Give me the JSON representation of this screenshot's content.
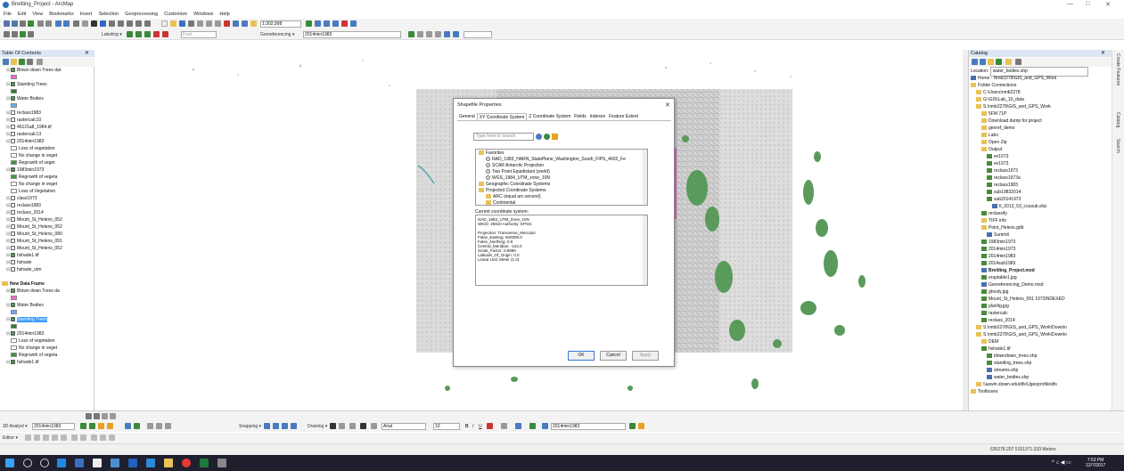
{
  "window": {
    "title": "Breitling_Project - ArcMap",
    "controls": [
      "—",
      "□",
      "✕"
    ]
  },
  "menu": [
    "File",
    "Edit",
    "View",
    "Bookmarks",
    "Insert",
    "Selection",
    "Geoprocessing",
    "Customize",
    "Windows",
    "Help"
  ],
  "toolbar": {
    "scale_value": "1:302,998",
    "labeling_label": "Labeling ▾",
    "font_value": "Font",
    "georef_label": "Georeferencing ▾",
    "georef_layer": "2014min1983"
  },
  "toc": {
    "title": "Table Of Contents",
    "items": [
      {
        "label": "Blown down Trees dat",
        "checked": true,
        "level": 1
      },
      {
        "label": "",
        "swatch": "#ff66cc",
        "level": 2
      },
      {
        "label": "Standing Trees",
        "checked": true,
        "level": 1
      },
      {
        "label": "",
        "swatch": "#2e7d32",
        "level": 2
      },
      {
        "label": "Water Bodies",
        "checked": true,
        "level": 1
      },
      {
        "label": "",
        "swatch": "#66aaff",
        "level": 2
      },
      {
        "label": "reclass1983",
        "checked": false,
        "level": 1
      },
      {
        "label": "rastercalc10",
        "checked": false,
        "level": 1
      },
      {
        "label": "46121a8_1984.tif",
        "checked": false,
        "level": 1
      },
      {
        "label": "rastercalc13",
        "checked": false,
        "level": 1
      },
      {
        "label": "2014min1983",
        "checked": false,
        "level": 1
      },
      {
        "label": "Loss of vegetation",
        "swatch": "#ffffff",
        "level": 2
      },
      {
        "label": "No change in veget",
        "swatch": "#ffffff",
        "level": 2
      },
      {
        "label": "Regrowth of veget",
        "swatch": "#3a9a3a",
        "level": 2
      },
      {
        "label": "1983min1973",
        "checked": true,
        "level": 1
      },
      {
        "label": "Regrowth of vegeta",
        "swatch": "#3a9a3a",
        "level": 2
      },
      {
        "label": "No change in veget",
        "swatch": "#ffffff",
        "level": 2
      },
      {
        "label": "Loss of Vegetation",
        "swatch": "#ffffff",
        "level": 2
      },
      {
        "label": "class1973",
        "checked": false,
        "level": 1
      },
      {
        "label": "reclass1983",
        "checked": false,
        "level": 1
      },
      {
        "label": "reclass_2014",
        "checked": false,
        "level": 1
      },
      {
        "label": "Mount_St_Helens_052",
        "checked": false,
        "level": 1
      },
      {
        "label": "Mount_St_Helens_052",
        "checked": false,
        "level": 1
      },
      {
        "label": "Mount_St_Helens_080",
        "checked": false,
        "level": 1
      },
      {
        "label": "Mount_St_Helens_091",
        "checked": false,
        "level": 1
      },
      {
        "label": "Mount_St_Helens_052",
        "checked": false,
        "level": 1
      },
      {
        "label": "hshade1.tif",
        "checked": true,
        "level": 1
      },
      {
        "label": "hshade",
        "checked": false,
        "level": 1
      },
      {
        "label": "hshade_utm",
        "checked": false,
        "level": 1
      },
      {
        "label": "",
        "spacer": true
      },
      {
        "label": "New Data Frame",
        "frame": true,
        "level": 0
      },
      {
        "label": "Blown down Trees da",
        "checked": true,
        "level": 1
      },
      {
        "label": "",
        "swatch": "#ff66cc",
        "level": 2
      },
      {
        "label": "Water Bodies",
        "checked": true,
        "level": 1
      },
      {
        "label": "",
        "swatch": "#66aaff",
        "level": 2
      },
      {
        "label": "Standing Trees",
        "checked": true,
        "level": 1,
        "selected": true
      },
      {
        "label": "",
        "swatch": "#2e7d32",
        "level": 2
      },
      {
        "label": "2014min1983",
        "checked": true,
        "level": 1
      },
      {
        "label": "Loss of vegetation",
        "swatch": "#ffffff",
        "level": 2
      },
      {
        "label": "No change in veget",
        "swatch": "#ffffff",
        "level": 2
      },
      {
        "label": "Regrowth of vegeta",
        "swatch": "#3a9a3a",
        "level": 2
      },
      {
        "label": "hshade1.tif",
        "checked": true,
        "level": 1
      }
    ]
  },
  "dialog": {
    "title": "Shapefile Properties",
    "close": "✕",
    "tabs": [
      "General",
      "XY Coordinate System",
      "Z Coordinate System",
      "Fields",
      "Indexes",
      "Feature Extent"
    ],
    "active_tab": "XY Coordinate System",
    "filter_placeholder": "Type here to search",
    "tree": [
      {
        "label": "Favorites",
        "type": "folder",
        "level": 0
      },
      {
        "label": "NAD_1983_HARN_StatePlane_Washington_South_FIPS_4602_Fe",
        "type": "globe",
        "level": 1
      },
      {
        "label": "SCAR Antarctic Projection",
        "type": "globe",
        "level": 1
      },
      {
        "label": "Two Point Equidistant (world)",
        "type": "globe",
        "level": 1
      },
      {
        "label": "WGS_1984_UTM_zone_10N",
        "type": "globe",
        "level": 1
      },
      {
        "label": "Geographic Coordinate Systems",
        "type": "folder",
        "level": 0
      },
      {
        "label": "Projected Coordinate Systems",
        "type": "folder",
        "level": 0
      },
      {
        "label": "ARC (equal arc-second)",
        "type": "folder",
        "level": 1
      },
      {
        "label": "Continental",
        "type": "folder",
        "level": 1
      }
    ],
    "current_label": "Current coordinate system:",
    "info_lines": [
      "NAD_1983_UTM_Zone_10N",
      "WKID: 26910 Authority: EPSG",
      "",
      "Projection: Transverse_Mercator",
      "False_Easting: 500000.0",
      "False_Northing: 0.0",
      "Central_Meridian: -123.0",
      "Scale_Factor: 0.9996",
      "Latitude_Of_Origin: 0.0",
      "Linear Unit: Meter (1.0)"
    ],
    "buttons": {
      "ok": "OK",
      "cancel": "Cancel",
      "apply": "Apply"
    }
  },
  "catalog": {
    "title": "Catalog",
    "location_label": "Location:",
    "location_value": "water_bodies.shp",
    "items": [
      {
        "label": "Home - Nmb2278\\GIS_and_GPS_Work",
        "level": 0,
        "icon": "b"
      },
      {
        "label": "Folder Connections",
        "level": 0,
        "icon": "y"
      },
      {
        "label": "C:\\Users\\nmb2278",
        "level": 1,
        "icon": "y"
      },
      {
        "label": "G:\\GIS\\Lab_10_data",
        "level": 1,
        "icon": "y"
      },
      {
        "label": "S:\\nmb2278\\GIS_and_GPS_Work",
        "level": 1,
        "icon": "y"
      },
      {
        "label": "5FM 71P",
        "level": 2,
        "icon": "y"
      },
      {
        "label": "Download dump for project",
        "level": 2,
        "icon": "y"
      },
      {
        "label": "georef_demo",
        "level": 2,
        "icon": "y"
      },
      {
        "label": "Labs",
        "level": 2,
        "icon": "y"
      },
      {
        "label": "Open Zip",
        "level": 2,
        "icon": "y"
      },
      {
        "label": "Output",
        "level": 2,
        "icon": "y"
      },
      {
        "label": "ev1973",
        "level": 3,
        "icon": "g"
      },
      {
        "label": "ev1973",
        "level": 3,
        "icon": "g"
      },
      {
        "label": "reclass1973",
        "level": 3,
        "icon": "g"
      },
      {
        "label": "reclass1973a",
        "level": 3,
        "icon": "g"
      },
      {
        "label": "reclass1983",
        "level": 3,
        "icon": "g"
      },
      {
        "label": "sub19832014",
        "level": 3,
        "icon": "g"
      },
      {
        "label": "sub20141973",
        "level": 3,
        "icon": "g"
      },
      {
        "label": "tl_2013_53_cousub.shp",
        "level": 4,
        "icon": "b"
      },
      {
        "label": "reclassify",
        "level": 2,
        "icon": "g"
      },
      {
        "label": "TIFF info",
        "level": 2,
        "icon": "y"
      },
      {
        "label": "Point_Helens.gdb",
        "level": 2,
        "icon": "y"
      },
      {
        "label": "Summit",
        "level": 3,
        "icon": "b"
      },
      {
        "label": "1983min1973",
        "level": 2,
        "icon": "g"
      },
      {
        "label": "2014min1973",
        "level": 2,
        "icon": "g"
      },
      {
        "label": "2014min1983",
        "level": 2,
        "icon": "g"
      },
      {
        "label": "2014sub1983",
        "level": 2,
        "icon": "g"
      },
      {
        "label": "Breitling_Project.mxd",
        "level": 2,
        "icon": "b",
        "bold": true
      },
      {
        "label": "eruptable1.jpg",
        "level": 2,
        "icon": "g"
      },
      {
        "label": "Georeferencing_Demo.mxd",
        "level": 2,
        "icon": "b"
      },
      {
        "label": "ghosty.jpg",
        "level": 2,
        "icon": "g"
      },
      {
        "label": "Mount_St_Helens_091 1973INDEXED",
        "level": 2,
        "icon": "g"
      },
      {
        "label": "planfig.jpg",
        "level": 2,
        "icon": "g"
      },
      {
        "label": "rastercalc",
        "level": 2,
        "icon": "g"
      },
      {
        "label": "reclass_2014",
        "level": 2,
        "icon": "g"
      },
      {
        "label": "S:\\nmb2278\\GIS_and_GPS_Work\\Downlo",
        "level": 1,
        "icon": "y"
      },
      {
        "label": "S:\\nmb2278\\GIS_and_GPS_Work\\Downlo",
        "level": 1,
        "icon": "y"
      },
      {
        "label": "DEM",
        "level": 2,
        "icon": "y"
      },
      {
        "label": "hshade1.tif",
        "level": 2,
        "icon": "g"
      },
      {
        "label": "blowndown_trees.shp",
        "level": 3,
        "icon": "g"
      },
      {
        "label": "standing_trees.shp",
        "level": 3,
        "icon": "g"
      },
      {
        "label": "streams.shp",
        "level": 3,
        "icon": "b"
      },
      {
        "label": "water_bodies.shp",
        "level": 3,
        "icon": "b"
      },
      {
        "label": "\\\\aswin.stown.edu\\dfs\\Ugeoprofile\\dfs",
        "level": 1,
        "icon": "y"
      },
      {
        "label": "Toolboxes",
        "level": 0,
        "icon": "y"
      }
    ]
  },
  "side_tabs": [
    "Create Features",
    "Catalog",
    "Search"
  ],
  "bottom": {
    "analyst_label": "3D Analyst ▾",
    "analyst_layer": "2014min1983",
    "snapping_label": "Snapping ▾",
    "drawing_label": "Drawing ▾",
    "font_value": "Arial",
    "font_size": "10",
    "layer_value": "2014min1983",
    "editor_label": "Editor ▾"
  },
  "status": {
    "coords": "635278.207  5151371.333 Meters"
  },
  "taskbar": {
    "time": "7:53 PM",
    "date": "12/7/2017"
  }
}
